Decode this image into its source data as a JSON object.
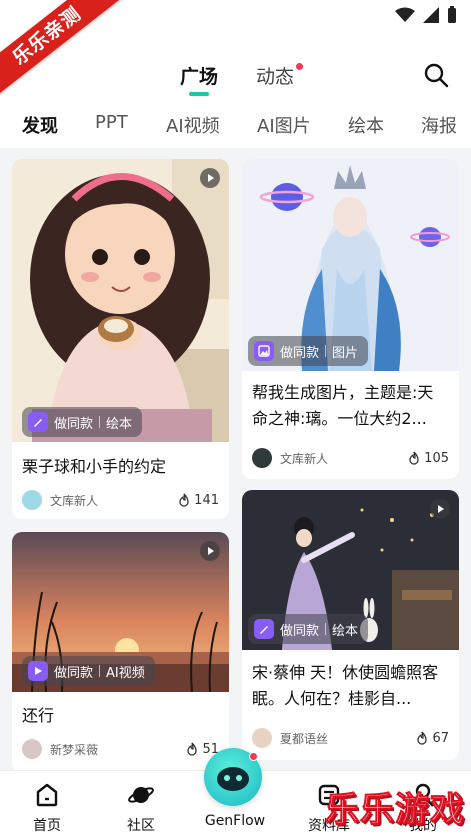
{
  "watermark_ribbon": "乐乐亲测",
  "watermark_site": "乐乐游戏",
  "top_tabs": [
    {
      "label": "广场",
      "active": true
    },
    {
      "label": "动态",
      "badge": true
    }
  ],
  "category_tabs": [
    "发现",
    "PPT",
    "AI视频",
    "AI图片",
    "绘本",
    "海报"
  ],
  "cards": [
    {
      "title": "栗子球和小手的约定",
      "tag_action": "做同款",
      "tag_type": "绘本",
      "author": "文库新人",
      "likes": "141",
      "has_play": true
    },
    {
      "title": "帮我生成图片，主题是:天命之神:璃。一位大约2...",
      "tag_action": "做同款",
      "tag_type": "图片",
      "author": "文库新人",
      "likes": "105",
      "has_play": false
    },
    {
      "title": "还行",
      "tag_action": "做同款",
      "tag_type": "AI视频",
      "author": "新梦采薇",
      "likes": "51",
      "has_play": true
    },
    {
      "title": "宋·蔡伸 天！休使圆蟾照客眠。人何在？桂影自...",
      "tag_action": "做同款",
      "tag_type": "绘本",
      "author": "夏都语丝",
      "likes": "67",
      "has_play": true
    }
  ],
  "bottom_nav": [
    {
      "label": "首页",
      "icon": "home-icon"
    },
    {
      "label": "社区",
      "icon": "planet-icon"
    },
    {
      "label": "GenFlow",
      "icon": "genflow-mascot-icon"
    },
    {
      "label": "资料库",
      "icon": "library-icon"
    },
    {
      "label": "我的",
      "icon": "profile-icon"
    }
  ],
  "colors": {
    "accent": "#1cc7a8",
    "badge": "#ef3b55",
    "tag_icon": "#8a5cf6"
  }
}
